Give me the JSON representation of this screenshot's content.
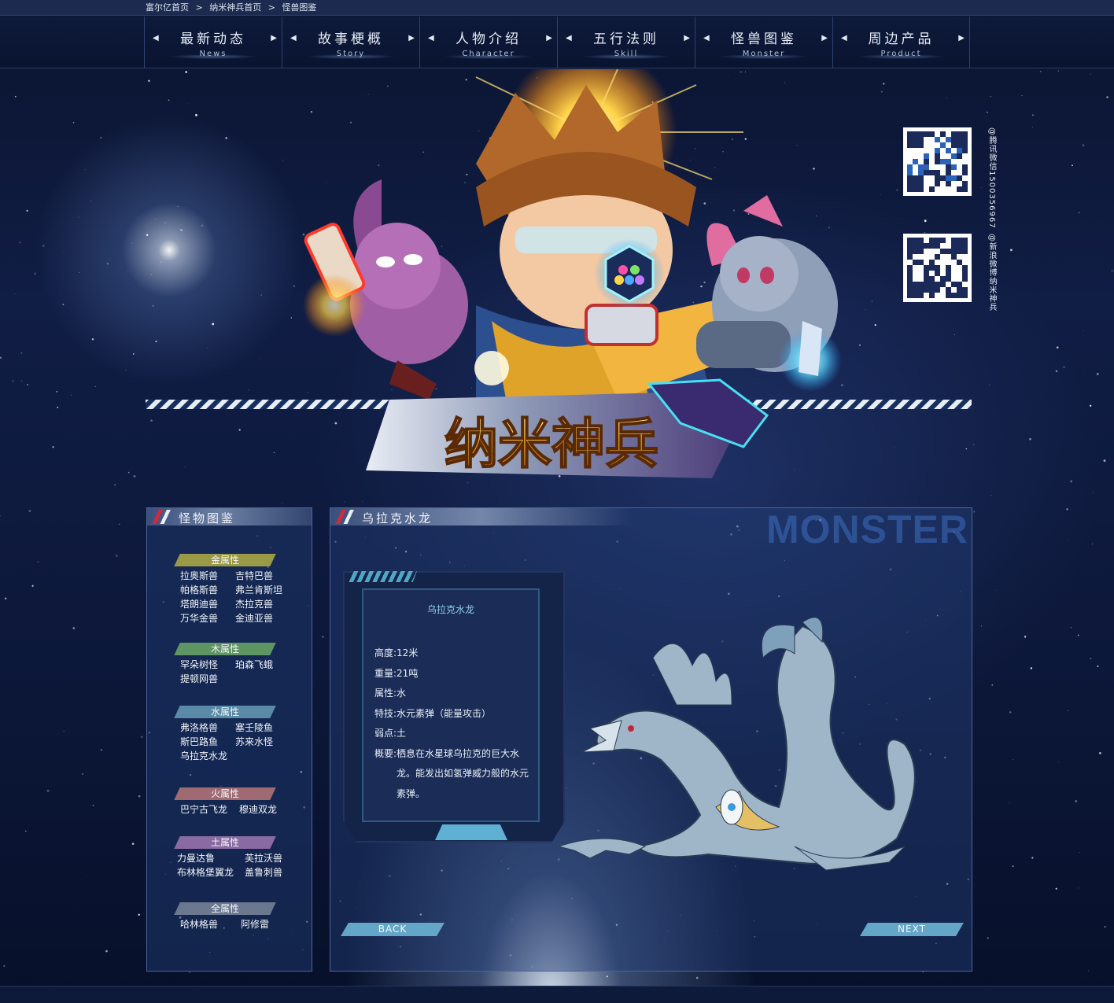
{
  "breadcrumb": {
    "items": [
      "富尔亿首页",
      "纳米神兵首页",
      "怪兽图鉴"
    ],
    "separator": ">"
  },
  "nav": {
    "items": [
      {
        "zh": "最新动态",
        "en": "News"
      },
      {
        "zh": "故事梗概",
        "en": "Story"
      },
      {
        "zh": "人物介绍",
        "en": "Character"
      },
      {
        "zh": "五行法则",
        "en": "Skill"
      },
      {
        "zh": "怪兽图鉴",
        "en": "Monster"
      },
      {
        "zh": "周边产品",
        "en": "Product"
      }
    ],
    "arrow_left": "◀",
    "arrow_right": "▶"
  },
  "banner": {
    "logo_text": "纳米神兵",
    "qr": [
      {
        "caption": "@腾讯微信1500356967"
      },
      {
        "caption": "@新浪微博纳米神兵"
      }
    ]
  },
  "sidebar": {
    "title": "怪物图鉴",
    "groups": [
      {
        "label": "金属性",
        "color": "#9a9a46",
        "monsters": [
          "拉奥斯兽",
          "吉特巴兽",
          "帕格斯兽",
          "弗兰肯斯坦",
          "塔朗迪兽",
          "杰拉克兽",
          "万华金兽",
          "金迪亚兽"
        ]
      },
      {
        "label": "木属性",
        "color": "#5f9463",
        "monsters": [
          "罕朵树怪",
          "珀森飞蛾",
          "提顿网兽"
        ]
      },
      {
        "label": "水属性",
        "color": "#5a8aa6",
        "monsters": [
          "弗洛格兽",
          "塞壬陵鱼",
          "斯巴路鱼",
          "苏来水怪",
          "乌拉克水龙"
        ]
      },
      {
        "label": "火属性",
        "color": "#a06a73",
        "monsters": [
          "巴宁古飞龙",
          "穆迪双龙"
        ]
      },
      {
        "label": "土属性",
        "color": "#8a6aa2",
        "monsters": [
          "力曼达鲁",
          "芙拉沃兽",
          "布林格堡翼龙",
          "盖鲁刺兽"
        ]
      },
      {
        "label": "全属性",
        "color": "#6b7890",
        "monsters": [
          "哈林格兽",
          "阿修雷"
        ]
      }
    ]
  },
  "main": {
    "title": "乌拉克水龙",
    "watermark": "MONSTER",
    "card": {
      "name": "乌拉克水龙",
      "stats": [
        {
          "key": "高度:",
          "value": "12米"
        },
        {
          "key": "重量:",
          "value": "21吨"
        },
        {
          "key": "属性:",
          "value": "水"
        },
        {
          "key": "特技:",
          "value": "水元素弹（能量攻击）"
        },
        {
          "key": "弱点:",
          "value": "土"
        },
        {
          "key": "概要:",
          "value": "栖息在水星球乌拉克的巨大水龙。能发出如氢弹威力般的水元素弹。"
        }
      ]
    },
    "back_label": "BACK",
    "next_label": "NEXT"
  },
  "colors": {
    "accent_red": "#d8263a",
    "button_blue": "#64a6c8",
    "panel_border": "#4b6598"
  }
}
